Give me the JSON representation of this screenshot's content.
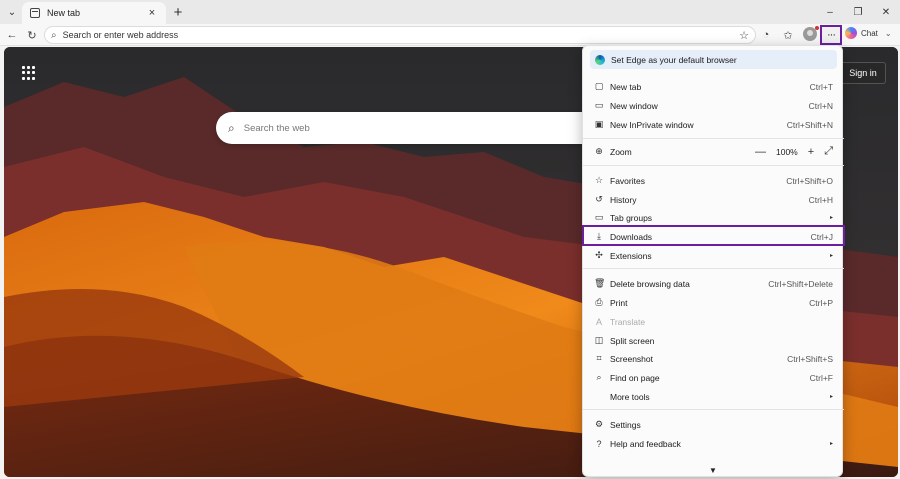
{
  "tab": {
    "title": "New tab",
    "close": "×",
    "new_tab": "+",
    "dropdown": "⌄"
  },
  "window": {
    "minimize": "–",
    "maximize": "❐",
    "close": "✕"
  },
  "toolbar": {
    "back": "←",
    "refresh": "↻",
    "address_placeholder": "Search or enter web address",
    "favorite_star": "☆",
    "more": "···",
    "chat_label": "Chat",
    "chat_caret": "⌄"
  },
  "page": {
    "search_placeholder": "Search the web",
    "sign_in": "Sign in"
  },
  "menu": {
    "promo": "Set Edge as your default browser",
    "items": [
      {
        "label": "New tab",
        "shortcut": "Ctrl+T",
        "icon": "new-tab-icon",
        "glyph": "▢"
      },
      {
        "label": "New window",
        "shortcut": "Ctrl+N",
        "icon": "new-window-icon",
        "glyph": "▭"
      },
      {
        "label": "New InPrivate window",
        "shortcut": "Ctrl+Shift+N",
        "icon": "inprivate-icon",
        "glyph": "▣"
      },
      {
        "label": "Zoom",
        "icon": "zoom-icon",
        "glyph": "⊕"
      },
      {
        "label": "Favorites",
        "shortcut": "Ctrl+Shift+O",
        "icon": "favorites-icon",
        "glyph": "☆"
      },
      {
        "label": "History",
        "shortcut": "Ctrl+H",
        "icon": "history-icon",
        "glyph": "↺"
      },
      {
        "label": "Tab groups",
        "icon": "tab-groups-icon",
        "glyph": "▭"
      },
      {
        "label": "Downloads",
        "shortcut": "Ctrl+J",
        "icon": "download-icon",
        "glyph": "⤓"
      },
      {
        "label": "Extensions",
        "icon": "extensions-icon",
        "glyph": "✣"
      },
      {
        "label": "Delete browsing data",
        "shortcut": "Ctrl+Shift+Delete",
        "icon": "delete-icon",
        "glyph": "🗑"
      },
      {
        "label": "Print",
        "shortcut": "Ctrl+P",
        "icon": "print-icon",
        "glyph": "⎙"
      },
      {
        "label": "Translate",
        "icon": "translate-icon",
        "glyph": "A"
      },
      {
        "label": "Split screen",
        "icon": "split-screen-icon",
        "glyph": "◫"
      },
      {
        "label": "Screenshot",
        "shortcut": "Ctrl+Shift+S",
        "icon": "screenshot-icon",
        "glyph": "⌗"
      },
      {
        "label": "Find on page",
        "shortcut": "Ctrl+F",
        "icon": "find-icon",
        "glyph": "⌕"
      },
      {
        "label": "More tools",
        "icon": "",
        "glyph": ""
      },
      {
        "label": "Settings",
        "icon": "settings-icon",
        "glyph": "⚙"
      },
      {
        "label": "Help and feedback",
        "icon": "help-icon",
        "glyph": "?"
      }
    ],
    "zoom": {
      "minus": "—",
      "value": "100%",
      "plus": "+",
      "fullscreen": "⤢"
    },
    "submenu_arrow": "▸",
    "scroll_down": "▼"
  },
  "colors": {
    "highlight": "#6b1e9e",
    "menu_bg": "#fbfbfb",
    "promo_bg": "#e6eefa"
  }
}
